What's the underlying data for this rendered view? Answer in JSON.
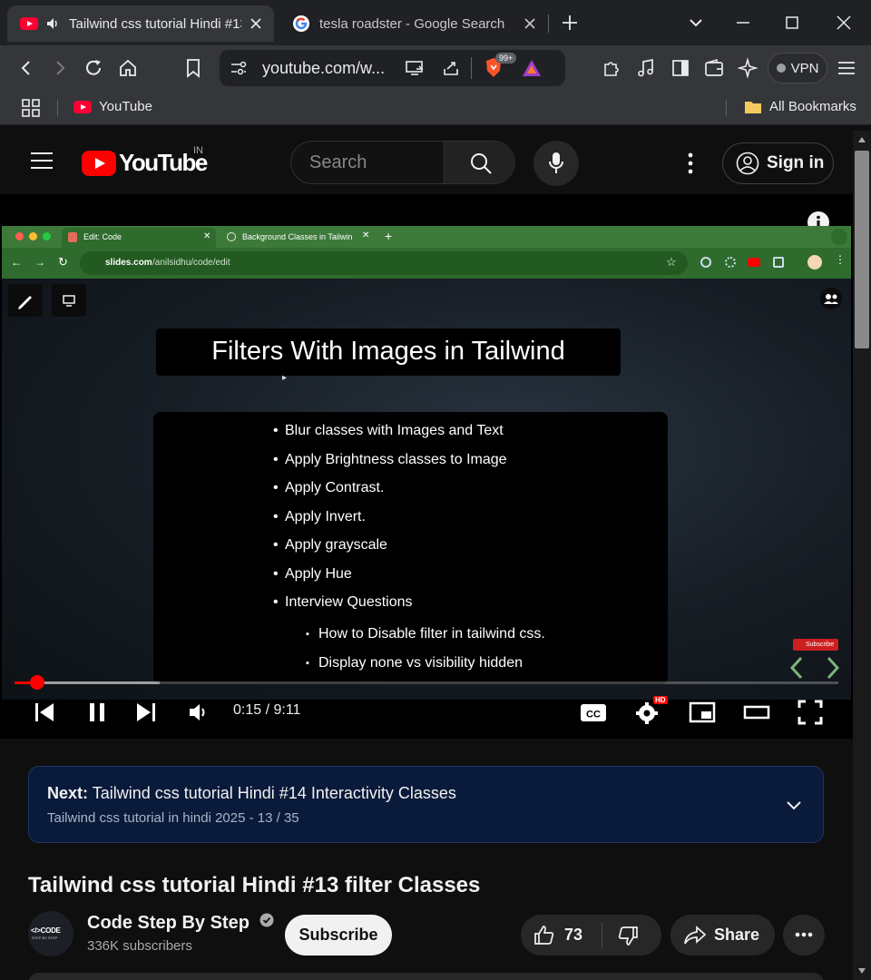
{
  "browser": {
    "tabs": [
      {
        "title": "Tailwind css tutorial Hindi #13 filter Classes",
        "active": true
      },
      {
        "title": "tesla roadster - Google Search",
        "active": false
      }
    ],
    "url": "youtube.com/w...",
    "brave_badge": "99+",
    "vpn_label": "VPN",
    "bookmarks": [
      {
        "label": "YouTube"
      }
    ],
    "all_bookmarks_label": "All Bookmarks"
  },
  "youtube": {
    "logo_text": "YouTube",
    "region": "IN",
    "search_placeholder": "Search",
    "signin_label": "Sign in"
  },
  "video_frame": {
    "inner_tabs": [
      "Edit: Code",
      "Background Classes in Tailwin"
    ],
    "inner_url_domain": "slides.com",
    "inner_url_path": "/anilsidhu/code/edit",
    "slide_title": "Filters With Images in Tailwind",
    "bullets": [
      "Blur classes with Images and Text",
      "Apply Brightness classes to Image",
      "Apply Contrast.",
      "Apply Invert.",
      "Apply grayscale",
      "Apply Hue",
      "Interview Questions"
    ],
    "sub_bullets": [
      "How to Disable filter in tailwind css.",
      "Display none vs visibility hidden"
    ],
    "subscribe_watermark": "Subscribe"
  },
  "player": {
    "time": "0:15 / 9:11",
    "progress_fraction": 0.027,
    "quality_badge": "HD",
    "cc_label": "CC"
  },
  "next_card": {
    "prefix": "Next:",
    "title": "Tailwind css tutorial Hindi #14 Interactivity Classes",
    "playlist": "Tailwind css tutorial in hindi 2025 - 13 / 35"
  },
  "video": {
    "title": "Tailwind css tutorial Hindi #13 filter Classes",
    "channel": "Code Step By Step",
    "subscribers": "336K subscribers",
    "subscribe_label": "Subscribe",
    "likes": "73",
    "share_label": "Share",
    "avatar_text": "</>CODE",
    "avatar_sub": "STEP BY STEP"
  },
  "colors": {
    "accent": "#ff0000",
    "next_card_bg": "#0a1a3a"
  }
}
